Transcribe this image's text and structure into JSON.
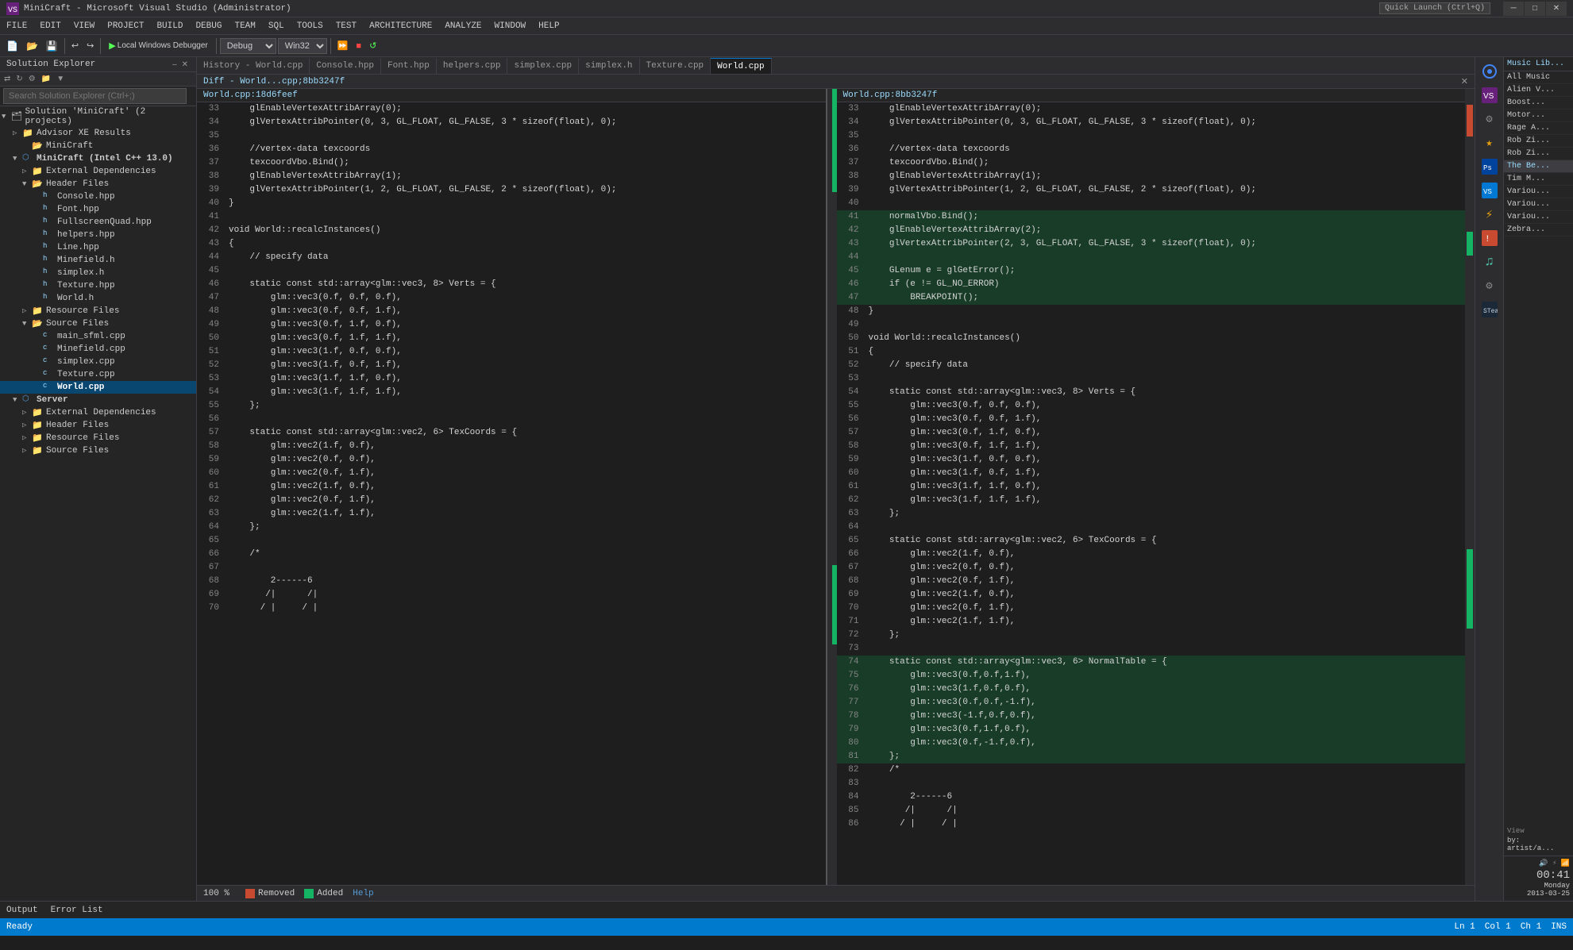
{
  "app": {
    "title": "MiniCraft - Microsoft Visual Studio (Administrator)",
    "quick_launch": "Quick Launch (Ctrl+Q)"
  },
  "menu": {
    "items": [
      "FILE",
      "EDIT",
      "VIEW",
      "PROJECT",
      "BUILD",
      "DEBUG",
      "TEAM",
      "SQL",
      "TOOLS",
      "TEST",
      "ARCHITECTURE",
      "ANALYZE",
      "WINDOW",
      "HELP"
    ]
  },
  "toolbar": {
    "debugger": "Local Windows Debugger",
    "config": "Debug",
    "platform": "Win32"
  },
  "tabs": [
    {
      "label": "History - World.cpp",
      "active": false
    },
    {
      "label": "Console.hpp",
      "active": false
    },
    {
      "label": "Font.hpp",
      "active": false
    },
    {
      "label": "helpers.cpp",
      "active": false
    },
    {
      "label": "simplex.cpp",
      "active": false
    },
    {
      "label": "simplex.h",
      "active": false
    },
    {
      "label": "Texture.cpp",
      "active": false
    },
    {
      "label": "World.cpp",
      "active": true
    }
  ],
  "diff_header": {
    "title": "Diff - World...cpp;8bb3247f",
    "left_file": "World.cpp:18d6feef",
    "right_file": "World.cpp:8bb3247f"
  },
  "solution_explorer": {
    "title": "Solution Explorer",
    "search_placeholder": "Search Solution Explorer (Ctrl+;)",
    "items": [
      {
        "indent": 0,
        "label": "Solution 'MiniCraft' (2 projects)",
        "type": "solution",
        "arrow": "▼"
      },
      {
        "indent": 1,
        "label": "Advisor XE Results",
        "type": "folder",
        "arrow": "▷"
      },
      {
        "indent": 2,
        "label": "MiniCraft",
        "type": "folder",
        "arrow": ""
      },
      {
        "indent": 1,
        "label": "MiniCraft (Intel C++ 13.0)",
        "type": "project",
        "arrow": "▼",
        "bold": true
      },
      {
        "indent": 2,
        "label": "External Dependencies",
        "type": "folder",
        "arrow": "▷"
      },
      {
        "indent": 2,
        "label": "Header Files",
        "type": "folder",
        "arrow": "▼"
      },
      {
        "indent": 3,
        "label": "Console.hpp",
        "type": "header",
        "arrow": ""
      },
      {
        "indent": 3,
        "label": "Font.hpp",
        "type": "header",
        "arrow": ""
      },
      {
        "indent": 3,
        "label": "FullscreenQuad.hpp",
        "type": "header",
        "arrow": ""
      },
      {
        "indent": 3,
        "label": "helpers.hpp",
        "type": "header",
        "arrow": ""
      },
      {
        "indent": 3,
        "label": "Line.hpp",
        "type": "header",
        "arrow": ""
      },
      {
        "indent": 3,
        "label": "Minefield.h",
        "type": "header",
        "arrow": ""
      },
      {
        "indent": 3,
        "label": "simplex.h",
        "type": "header",
        "arrow": ""
      },
      {
        "indent": 3,
        "label": "Texture.hpp",
        "type": "header",
        "arrow": ""
      },
      {
        "indent": 3,
        "label": "World.h",
        "type": "header",
        "arrow": ""
      },
      {
        "indent": 2,
        "label": "Resource Files",
        "type": "folder",
        "arrow": "▷"
      },
      {
        "indent": 2,
        "label": "Source Files",
        "type": "folder",
        "arrow": "▼"
      },
      {
        "indent": 3,
        "label": "main_sfml.cpp",
        "type": "source",
        "arrow": ""
      },
      {
        "indent": 3,
        "label": "Minefield.cpp",
        "type": "source",
        "arrow": ""
      },
      {
        "indent": 3,
        "label": "simplex.cpp",
        "type": "source",
        "arrow": ""
      },
      {
        "indent": 3,
        "label": "Texture.cpp",
        "type": "source",
        "arrow": ""
      },
      {
        "indent": 3,
        "label": "World.cpp",
        "type": "source",
        "arrow": "",
        "selected": true
      },
      {
        "indent": 1,
        "label": "Server",
        "type": "project",
        "arrow": "▼",
        "bold": true
      },
      {
        "indent": 2,
        "label": "External Dependencies",
        "type": "folder",
        "arrow": "▷"
      },
      {
        "indent": 2,
        "label": "Header Files",
        "type": "folder",
        "arrow": "▷"
      },
      {
        "indent": 2,
        "label": "Resource Files",
        "type": "folder",
        "arrow": "▷"
      },
      {
        "indent": 2,
        "label": "Source Files",
        "type": "folder",
        "arrow": "▷"
      }
    ]
  },
  "left_code": {
    "filename": "World.cpp:18d6feef",
    "lines": [
      {
        "num": 33,
        "text": "    glEnableVertexAttribArray(0);",
        "type": "normal"
      },
      {
        "num": 34,
        "text": "    glVertexAttribPointer(0, 3, GL_FLOAT, GL_FALSE, 3 * sizeof(float), 0);",
        "type": "normal"
      },
      {
        "num": 35,
        "text": "",
        "type": "normal"
      },
      {
        "num": 36,
        "text": "    //vertex-data texcoords",
        "type": "normal"
      },
      {
        "num": 37,
        "text": "    texcoordVbo.Bind();",
        "type": "normal"
      },
      {
        "num": 38,
        "text": "    glEnableVertexAttribArray(1);",
        "type": "normal"
      },
      {
        "num": 39,
        "text": "    glVertexAttribPointer(1, 2, GL_FLOAT, GL_FALSE, 2 * sizeof(float), 0);",
        "type": "normal"
      },
      {
        "num": 40,
        "text": "}",
        "type": "normal"
      },
      {
        "num": 41,
        "text": "",
        "type": "normal"
      },
      {
        "num": 42,
        "text": "void World::recalcInstances()",
        "type": "normal"
      },
      {
        "num": 43,
        "text": "{",
        "type": "normal"
      },
      {
        "num": 44,
        "text": "    // specify data",
        "type": "normal"
      },
      {
        "num": 45,
        "text": "",
        "type": "normal"
      },
      {
        "num": 46,
        "text": "    static const std::array<glm::vec3, 8> Verts = {",
        "type": "normal"
      },
      {
        "num": 47,
        "text": "        glm::vec3(0.f, 0.f, 0.f),",
        "type": "normal"
      },
      {
        "num": 48,
        "text": "        glm::vec3(0.f, 0.f, 1.f),",
        "type": "normal"
      },
      {
        "num": 49,
        "text": "        glm::vec3(0.f, 1.f, 0.f),",
        "type": "normal"
      },
      {
        "num": 50,
        "text": "        glm::vec3(0.f, 1.f, 1.f),",
        "type": "normal"
      },
      {
        "num": 51,
        "text": "        glm::vec3(1.f, 0.f, 0.f),",
        "type": "normal"
      },
      {
        "num": 52,
        "text": "        glm::vec3(1.f, 0.f, 1.f),",
        "type": "normal"
      },
      {
        "num": 53,
        "text": "        glm::vec3(1.f, 1.f, 0.f),",
        "type": "normal"
      },
      {
        "num": 54,
        "text": "        glm::vec3(1.f, 1.f, 1.f),",
        "type": "normal"
      },
      {
        "num": 55,
        "text": "    };",
        "type": "normal"
      },
      {
        "num": 56,
        "text": "",
        "type": "normal"
      },
      {
        "num": 57,
        "text": "    static const std::array<glm::vec2, 6> TexCoords = {",
        "type": "normal"
      },
      {
        "num": 58,
        "text": "        glm::vec2(1.f, 0.f),",
        "type": "normal"
      },
      {
        "num": 59,
        "text": "        glm::vec2(0.f, 0.f),",
        "type": "normal"
      },
      {
        "num": 60,
        "text": "        glm::vec2(0.f, 1.f),",
        "type": "normal"
      },
      {
        "num": 61,
        "text": "        glm::vec2(1.f, 0.f),",
        "type": "normal"
      },
      {
        "num": 62,
        "text": "        glm::vec2(0.f, 1.f),",
        "type": "normal"
      },
      {
        "num": 63,
        "text": "        glm::vec2(1.f, 1.f),",
        "type": "normal"
      },
      {
        "num": 64,
        "text": "    };",
        "type": "normal"
      },
      {
        "num": 65,
        "text": "",
        "type": "normal"
      },
      {
        "num": 66,
        "text": "    /*",
        "type": "normal"
      },
      {
        "num": 67,
        "text": "",
        "type": "normal"
      },
      {
        "num": 68,
        "text": "        2------6",
        "type": "normal"
      },
      {
        "num": 69,
        "text": "       /|      /|",
        "type": "normal"
      },
      {
        "num": 70,
        "text": "      / |     / |",
        "type": "normal"
      }
    ]
  },
  "right_code": {
    "filename": "World.cpp:8bb3247f",
    "lines": [
      {
        "num": 33,
        "text": "    glEnableVertexAttribArray(0);",
        "type": "normal"
      },
      {
        "num": 34,
        "text": "    glVertexAttribPointer(0, 3, GL_FLOAT, GL_FALSE, 3 * sizeof(float), 0);",
        "type": "normal"
      },
      {
        "num": 35,
        "text": "",
        "type": "normal"
      },
      {
        "num": 36,
        "text": "    //vertex-data texcoords",
        "type": "normal"
      },
      {
        "num": 37,
        "text": "    texcoordVbo.Bind();",
        "type": "normal"
      },
      {
        "num": 38,
        "text": "    glEnableVertexAttribArray(1);",
        "type": "normal"
      },
      {
        "num": 39,
        "text": "    glVertexAttribPointer(1, 2, GL_FLOAT, GL_FALSE, 2 * sizeof(float), 0);",
        "type": "normal"
      },
      {
        "num": 40,
        "text": "",
        "type": "normal"
      },
      {
        "num": 41,
        "text": "    normalVbo.Bind();",
        "type": "added"
      },
      {
        "num": 42,
        "text": "    glEnableVertexAttribArray(2);",
        "type": "added"
      },
      {
        "num": 43,
        "text": "    glVertexAttribPointer(2, 3, GL_FLOAT, GL_FALSE, 3 * sizeof(float), 0);",
        "type": "added"
      },
      {
        "num": 44,
        "text": "",
        "type": "added"
      },
      {
        "num": 45,
        "text": "    GLenum e = glGetError();",
        "type": "added"
      },
      {
        "num": 46,
        "text": "    if (e != GL_NO_ERROR)",
        "type": "added"
      },
      {
        "num": 47,
        "text": "        BREAKPOINT();",
        "type": "added"
      },
      {
        "num": 48,
        "text": "}",
        "type": "normal"
      },
      {
        "num": 49,
        "text": "",
        "type": "normal"
      },
      {
        "num": 50,
        "text": "void World::recalcInstances()",
        "type": "normal"
      },
      {
        "num": 51,
        "text": "{",
        "type": "normal"
      },
      {
        "num": 52,
        "text": "    // specify data",
        "type": "normal"
      },
      {
        "num": 53,
        "text": "",
        "type": "normal"
      },
      {
        "num": 54,
        "text": "    static const std::array<glm::vec3, 8> Verts = {",
        "type": "normal"
      },
      {
        "num": 55,
        "text": "        glm::vec3(0.f, 0.f, 0.f),",
        "type": "normal"
      },
      {
        "num": 56,
        "text": "        glm::vec3(0.f, 0.f, 1.f),",
        "type": "normal"
      },
      {
        "num": 57,
        "text": "        glm::vec3(0.f, 1.f, 0.f),",
        "type": "normal"
      },
      {
        "num": 58,
        "text": "        glm::vec3(0.f, 1.f, 1.f),",
        "type": "normal"
      },
      {
        "num": 59,
        "text": "        glm::vec3(1.f, 0.f, 0.f),",
        "type": "normal"
      },
      {
        "num": 60,
        "text": "        glm::vec3(1.f, 0.f, 1.f),",
        "type": "normal"
      },
      {
        "num": 61,
        "text": "        glm::vec3(1.f, 1.f, 0.f),",
        "type": "normal"
      },
      {
        "num": 62,
        "text": "        glm::vec3(1.f, 1.f, 1.f),",
        "type": "normal"
      },
      {
        "num": 63,
        "text": "    };",
        "type": "normal"
      },
      {
        "num": 64,
        "text": "",
        "type": "normal"
      },
      {
        "num": 65,
        "text": "    static const std::array<glm::vec2, 6> TexCoords = {",
        "type": "normal"
      },
      {
        "num": 66,
        "text": "        glm::vec2(1.f, 0.f),",
        "type": "normal"
      },
      {
        "num": 67,
        "text": "        glm::vec2(0.f, 0.f),",
        "type": "normal"
      },
      {
        "num": 68,
        "text": "        glm::vec2(0.f, 1.f),",
        "type": "normal"
      },
      {
        "num": 69,
        "text": "        glm::vec2(1.f, 0.f),",
        "type": "normal"
      },
      {
        "num": 70,
        "text": "        glm::vec2(0.f, 1.f),",
        "type": "normal"
      },
      {
        "num": 71,
        "text": "        glm::vec2(1.f, 1.f),",
        "type": "normal"
      },
      {
        "num": 72,
        "text": "    };",
        "type": "normal"
      },
      {
        "num": 73,
        "text": "",
        "type": "normal"
      },
      {
        "num": 74,
        "text": "    static const std::array<glm::vec3, 6> NormalTable = {",
        "type": "added"
      },
      {
        "num": 75,
        "text": "        glm::vec3(0.f,0.f,1.f),",
        "type": "added"
      },
      {
        "num": 76,
        "text": "        glm::vec3(1.f,0.f,0.f),",
        "type": "added"
      },
      {
        "num": 77,
        "text": "        glm::vec3(0.f,0.f,-1.f),",
        "type": "added"
      },
      {
        "num": 78,
        "text": "        glm::vec3(-1.f,0.f,0.f),",
        "type": "added"
      },
      {
        "num": 79,
        "text": "        glm::vec3(0.f,1.f,0.f),",
        "type": "added"
      },
      {
        "num": 80,
        "text": "        glm::vec3(0.f,-1.f,0.f),",
        "type": "added"
      },
      {
        "num": 81,
        "text": "    };",
        "type": "added"
      },
      {
        "num": 82,
        "text": "    /*",
        "type": "normal"
      },
      {
        "num": 83,
        "text": "",
        "type": "normal"
      },
      {
        "num": 84,
        "text": "        2------6",
        "type": "normal"
      },
      {
        "num": 85,
        "text": "       /|      /|",
        "type": "normal"
      },
      {
        "num": 86,
        "text": "      / |     / |",
        "type": "normal"
      }
    ]
  },
  "diff_legend": {
    "removed_label": "Removed",
    "added_label": "Added",
    "help_label": "Help"
  },
  "status_bar": {
    "ready": "Ready",
    "ln": "Ln 1",
    "col": "Col 1",
    "ch": "Ch 1",
    "ins": "INS"
  },
  "bottom_panel": {
    "tabs": [
      "Output",
      "Error List"
    ]
  },
  "right_panel": {
    "music_label": "Music Lib...",
    "apps": [
      "All Music",
      "Alien V...",
      "Boost...",
      "Motor...",
      "Rage A...",
      "Rob Zi...",
      "Rob Zi...",
      "The Be...",
      "Tim M...",
      "Variou...",
      "Variou...",
      "Variou...",
      "Zebra..."
    ],
    "view_label": "View",
    "view_val": "by: artist/a..."
  },
  "time": {
    "time": "00:41",
    "day": "Monday",
    "date": "2013-03-25"
  },
  "zoom": "100 %"
}
